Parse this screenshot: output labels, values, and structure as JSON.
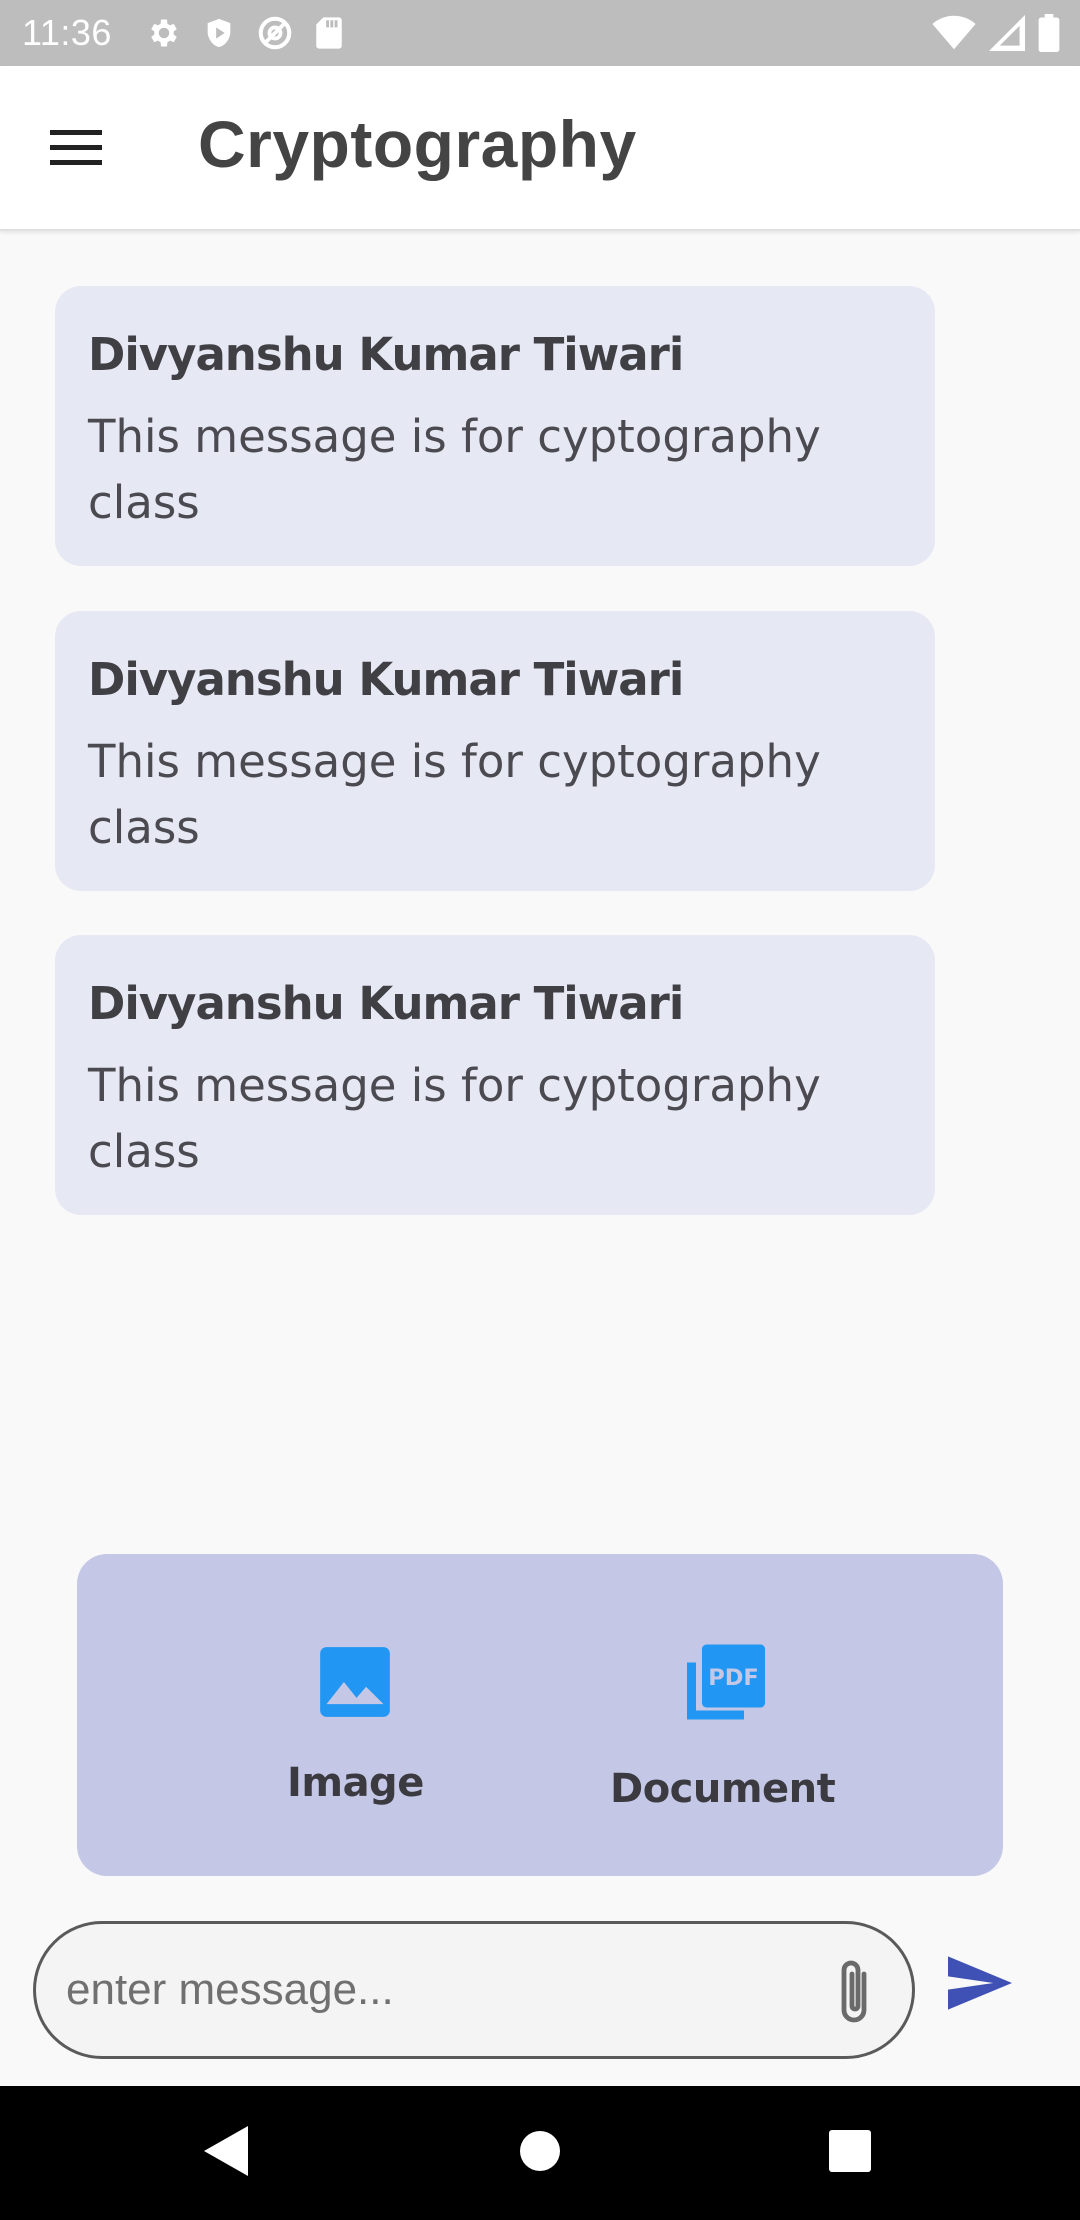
{
  "status_bar": {
    "time": "11:36",
    "icons_left": [
      "settings-icon",
      "shield-icon",
      "at-icon",
      "sd-card-icon"
    ],
    "icons_right": [
      "wifi-icon",
      "signal-icon",
      "battery-icon"
    ]
  },
  "app_bar": {
    "title": "Cryptography",
    "menu_icon": "hamburger-menu-icon"
  },
  "messages": [
    {
      "sender": "Divyanshu Kumar Tiwari",
      "text": "This message is for cyptography class"
    },
    {
      "sender": "Divyanshu Kumar Tiwari",
      "text": "This message is for cyptography class"
    },
    {
      "sender": "Divyanshu Kumar Tiwari",
      "text": "This message is for cyptography class"
    }
  ],
  "attachment_panel": {
    "options": [
      {
        "label": "Image",
        "icon": "image-icon"
      },
      {
        "label": "Document",
        "icon": "pdf-icon"
      }
    ]
  },
  "composer": {
    "placeholder": "enter message...",
    "value": "",
    "attach_icon": "paperclip-icon",
    "send_icon": "send-icon"
  },
  "nav_bar": {
    "buttons": [
      "back-icon",
      "home-icon",
      "recents-icon"
    ]
  },
  "colors": {
    "accent": "#3f51b5",
    "icon_blue": "#2196f3",
    "card_bg": "#e6e8f4",
    "panel_bg": "#c4c8e6"
  }
}
